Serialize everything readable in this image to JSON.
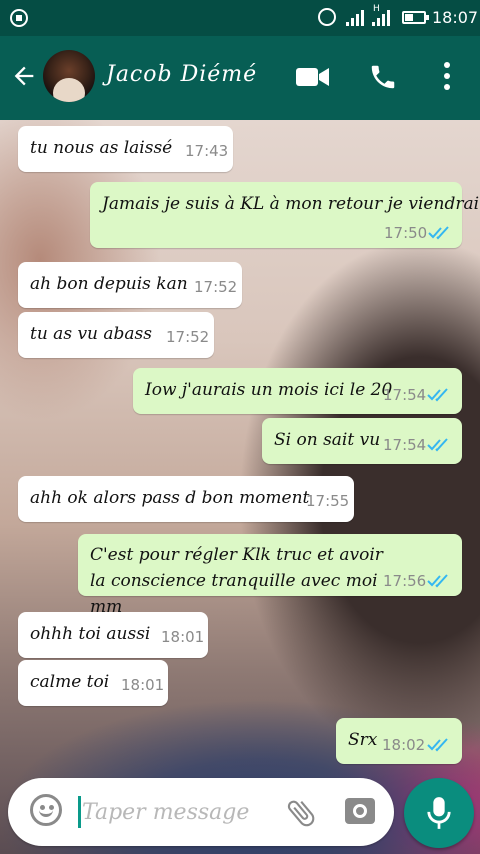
{
  "status_bar": {
    "time": "18:07",
    "network_type": "H",
    "icons": [
      "app-notification-icon",
      "alarm-icon",
      "signal-icon",
      "signal-icon",
      "battery-icon"
    ]
  },
  "header": {
    "contact_name": "Jacob Diémé",
    "icons": [
      "back-arrow-icon",
      "video-call-icon",
      "phone-icon",
      "more-options-icon"
    ]
  },
  "messages": [
    {
      "direction": "in",
      "text": "tu nous as laissé",
      "time": "17:43"
    },
    {
      "direction": "out",
      "text": "Jamais je suis à KL à mon retour je viendrai",
      "time": "17:50",
      "read": true
    },
    {
      "direction": "in",
      "text": "ah bon depuis kan",
      "time": "17:52"
    },
    {
      "direction": "in",
      "text": "tu as vu abass",
      "time": "17:52"
    },
    {
      "direction": "out",
      "text": "Iow j'aurais un mois ici le 20",
      "time": "17:54",
      "read": true
    },
    {
      "direction": "out",
      "text": "Si on sait vu",
      "time": "17:54",
      "read": true
    },
    {
      "direction": "in",
      "text": "ahh ok alors pass d bon moment",
      "time": "17:55"
    },
    {
      "direction": "out",
      "text": "C'est pour régler Klk truc et avoir la conscience tranquille avec moi mm",
      "time": "17:56",
      "read": true
    },
    {
      "direction": "in",
      "text": "ohhh toi aussi",
      "time": "18:01"
    },
    {
      "direction": "in",
      "text": "calme toi",
      "time": "18:01"
    },
    {
      "direction": "out",
      "text": "Srx",
      "time": "18:02",
      "read": true
    }
  ],
  "composer": {
    "placeholder": "Taper message",
    "value": "",
    "icons": [
      "emoji-icon",
      "attach-icon",
      "camera-icon",
      "mic-icon"
    ]
  },
  "colors": {
    "status_bar": "#054d44",
    "toolbar": "#075e54",
    "outgoing_bubble": "#dcf8c6",
    "incoming_bubble": "#ffffff",
    "read_ticks": "#34b7f1",
    "mic_button": "#0a8d7e"
  }
}
